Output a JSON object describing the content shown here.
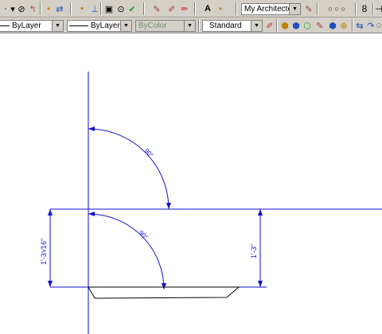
{
  "toolbar_top": {
    "text_style": "My Architecte",
    "icons": [
      "pan-icon",
      "circle-slash-icon",
      "snap-icon",
      "properties-icon",
      "dimension-icon",
      "insert-icon",
      "block-icon",
      "regen-icon",
      "check-icon",
      "match-properties-icon",
      "pencil-icon",
      "edit-icon",
      "text-style-icon",
      "text-icon",
      "dim-style-icon",
      "ortho-icon",
      "polar-icon",
      "osnap-icon",
      "eight-icon"
    ],
    "osnap_markers": "○ ○ ○",
    "last_button": "8"
  },
  "toolbar_props": {
    "linetype": "ByLayer",
    "lineweight": "ByLayer",
    "plot_style": "ByColor",
    "plot_style_color": "#6b8f6b",
    "standard": "Standard"
  },
  "colors": {
    "toolbar_bg": "#d4d0c8",
    "dim_line": "#1010d0",
    "object_line": "#000000",
    "canvas_bg": "#ffffff"
  },
  "drawing": {
    "angle_upper": "90°",
    "angle_lower": "90°",
    "dim_left": "1'-3⁵⁄16\"",
    "dim_right": "1'-3\""
  }
}
